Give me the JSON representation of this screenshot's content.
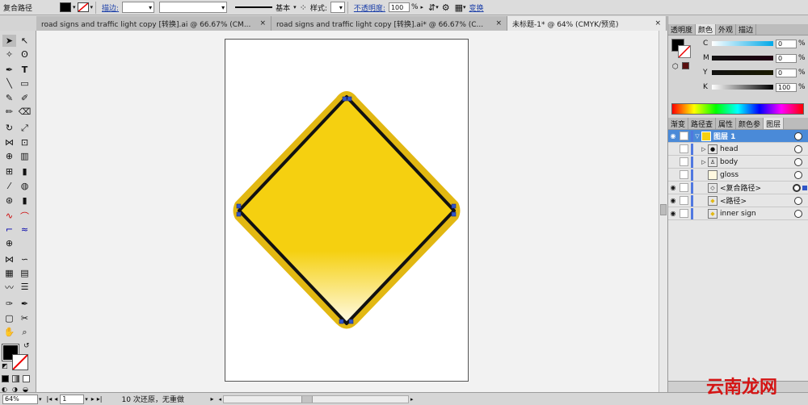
{
  "control_bar": {
    "mode_label": "复合路径",
    "stroke_label": "描边:",
    "profile_label": "基本",
    "style_label": "样式:",
    "opacity_label": "不透明度:",
    "opacity_value": "100",
    "opacity_unit": "%",
    "transform_label": "变换"
  },
  "tabs": [
    {
      "label": "road signs and traffic light copy [转换].ai @ 66.67% (CM...",
      "close": "×"
    },
    {
      "label": "road signs and traffic light copy [转换].ai* @ 66.67% (C...",
      "close": "×"
    },
    {
      "label": "未标题-1* @ 64% (CMYK/预览)",
      "close": "×"
    }
  ],
  "color_panel": {
    "tabs": [
      "透明度",
      "颜色",
      "外观",
      "描边"
    ],
    "channels": [
      {
        "name": "C",
        "value": "0",
        "unit": "%"
      },
      {
        "name": "M",
        "value": "0",
        "unit": "%"
      },
      {
        "name": "Y",
        "value": "0",
        "unit": "%"
      },
      {
        "name": "K",
        "value": "100",
        "unit": "%"
      }
    ]
  },
  "layers_panel": {
    "tabs": [
      "渐变",
      "路径查",
      "属性",
      "颜色参",
      "图层"
    ],
    "rows": [
      {
        "name": "图层 1"
      },
      {
        "name": "head"
      },
      {
        "name": "body"
      },
      {
        "name": "gloss"
      },
      {
        "name": "<复合路径>"
      },
      {
        "name": "<路径>"
      },
      {
        "name": "inner sign"
      }
    ]
  },
  "status_bar": {
    "zoom": "64%",
    "page": "1",
    "undo_text": "10 次还原，无重做"
  },
  "colors": {
    "sign_yellow": "#f5d010",
    "sign_outline": "#e2b812",
    "stroke_black": "#111111",
    "anchor_blue": "#3056c8",
    "selection_blue": "#4a8ad8"
  },
  "watermark": "云南龙网"
}
